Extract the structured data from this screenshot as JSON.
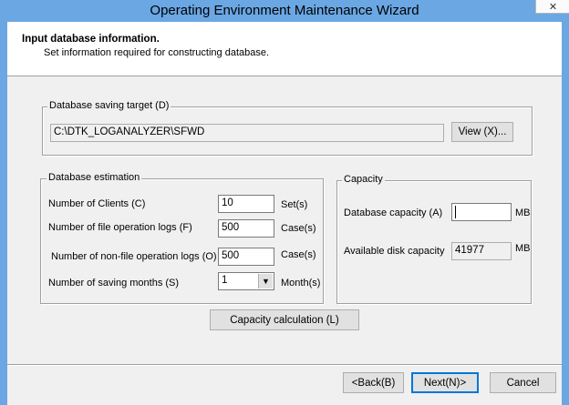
{
  "window": {
    "title": "Operating Environment Maintenance Wizard",
    "close_glyph": "✕"
  },
  "header": {
    "title": "Input database information.",
    "subtitle": "Set information required for constructing database."
  },
  "saving_target": {
    "group_label": "Database saving target (D)",
    "path": "C:\\DTK_LOGANALYZER\\SFWD",
    "view_button": "View (X)..."
  },
  "estimation": {
    "group_label": "Database estimation",
    "clients": {
      "label": "Number of Clients (C)",
      "value": "10",
      "unit": "Set(s)"
    },
    "file_logs": {
      "label": "Number of file operation logs (F)",
      "value": "500",
      "unit": "Case(s)"
    },
    "nonfile_logs": {
      "label": "Number of non-file operation logs (O)",
      "value": "500",
      "unit": "Case(s)"
    },
    "saving_months": {
      "label": "Number of saving months (S)",
      "value": "1",
      "unit": "Month(s)",
      "arrow": "▼"
    }
  },
  "capacity": {
    "group_label": "Capacity",
    "db_capacity": {
      "label": "Database capacity (A)",
      "value": "",
      "unit": "MB"
    },
    "available": {
      "label": "Available disk capacity",
      "value": "41977",
      "unit": "MB"
    }
  },
  "calc_button": "Capacity calculation (L)",
  "footer": {
    "back": "<Back(B)",
    "next": "Next(N)>",
    "cancel": "Cancel"
  }
}
